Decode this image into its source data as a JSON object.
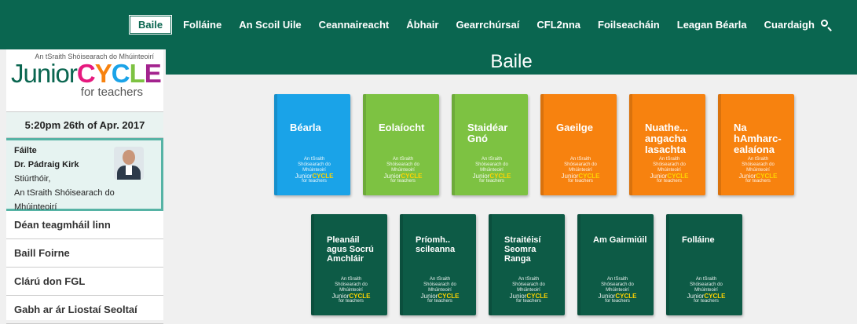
{
  "nav": {
    "items": [
      "Baile",
      "Folláine",
      "An Scoil Uile",
      "Ceannaireacht",
      "Ábhair",
      "Gearrchúrsaí",
      "CFL2nna",
      "Foilseacháin",
      "Leagan Béarla",
      "Cuardaigh"
    ],
    "active": "Baile",
    "search_icon": "search-icon"
  },
  "sidebar": {
    "logo_sub": "An tSraith Shóisearach do Mhúinteoirí",
    "logo_junior": "Junior",
    "logo_cycle": "CYCLE",
    "logo_for": "for teachers",
    "datetime": "5:20pm  26th of Apr. 2017",
    "welcome": {
      "greeting": "Fáilte",
      "name": "Dr. Pádraig Kirk",
      "role": "Stiúrthóir,",
      "org1": "An tSraith Shóisearach do",
      "org2": "Mhúinteoirí"
    },
    "links": [
      "Déan teagmháil linn",
      "Baill Foirne",
      "Clárú don FGL",
      "Gabh ar ár Liostaí Seoltaí"
    ]
  },
  "main": {
    "title": "Baile",
    "cards_row1": [
      {
        "label": "Béarla",
        "color": "#1aa3e8"
      },
      {
        "label": "Eolaíocht",
        "color": "#7dc242"
      },
      {
        "label": "Staidéar Gnó",
        "color": "#7dc242"
      },
      {
        "label": "Gaeilge",
        "color": "#f7820f"
      },
      {
        "label": "Nuathe... angacha Iasachta",
        "color": "#f7820f"
      },
      {
        "label": "Na hAmharc-ealaíona",
        "color": "#f7820f"
      }
    ],
    "cards_row2": [
      {
        "label": "Pleanáil agus Socrú Amchláir",
        "color": "#0d5b46"
      },
      {
        "label": "Príomh.. scileanna",
        "color": "#0d5b46"
      },
      {
        "label": "Straitéisí Seomra Ranga",
        "color": "#0d5b46"
      },
      {
        "label": "Am Gairmiúil",
        "color": "#0d5b46"
      },
      {
        "label": "Folláine",
        "color": "#0d5b46"
      }
    ],
    "card_logo": {
      "sub": "An tSraith Shóisearach do Mhúinteoirí",
      "junior": "Junior",
      "cycle": "CYCLE",
      "for": "for teachers"
    }
  }
}
